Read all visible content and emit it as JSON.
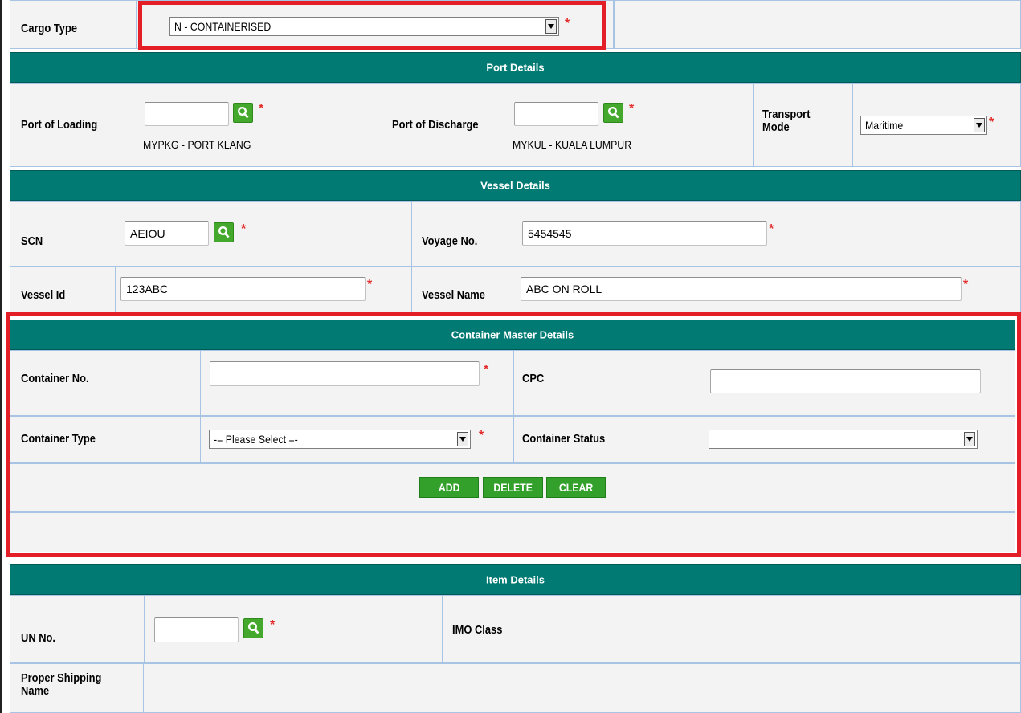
{
  "cargo": {
    "label": "Cargo Type",
    "value": "N - CONTAINERISED"
  },
  "port": {
    "header": "Port Details",
    "loading_label": "Port of Loading",
    "loading_value": "",
    "loading_desc": "MYPKG - PORT KLANG",
    "discharge_label": "Port of Discharge",
    "discharge_value": "",
    "discharge_desc": "MYKUL - KUALA LUMPUR",
    "transport_label": "Transport Mode",
    "transport_value": "Maritime"
  },
  "vessel": {
    "header": "Vessel Details",
    "scn_label": "SCN",
    "scn_value": "AEIOU",
    "voyage_label": "Voyage No.",
    "voyage_value": "5454545",
    "vessel_id_label": "Vessel Id",
    "vessel_id_value": "123ABC",
    "vessel_name_label": "Vessel Name",
    "vessel_name_value": "ABC ON ROLL"
  },
  "container": {
    "header": "Container Master Details",
    "no_label": "Container No.",
    "no_value": "",
    "cpc_label": "CPC",
    "cpc_value": "",
    "type_label": "Container Type",
    "type_value": "-= Please Select =-",
    "status_label": "Container Status",
    "status_value": "",
    "add_label": "ADD",
    "delete_label": "DELETE",
    "clear_label": "CLEAR"
  },
  "item": {
    "header": "Item Details",
    "un_label": "UN No.",
    "un_value": "",
    "imo_label": "IMO Class",
    "psn_label": "Proper Shipping Name"
  },
  "required_marker": "*",
  "colors": {
    "header_bg": "#007a73",
    "cell_bg": "#f3f3f3",
    "button_bg": "#33a02c",
    "highlight": "#e41e26",
    "required": "#e32b2b"
  },
  "icons": {
    "search": "magnifier-icon",
    "dropdown": "chevron-down-icon"
  }
}
